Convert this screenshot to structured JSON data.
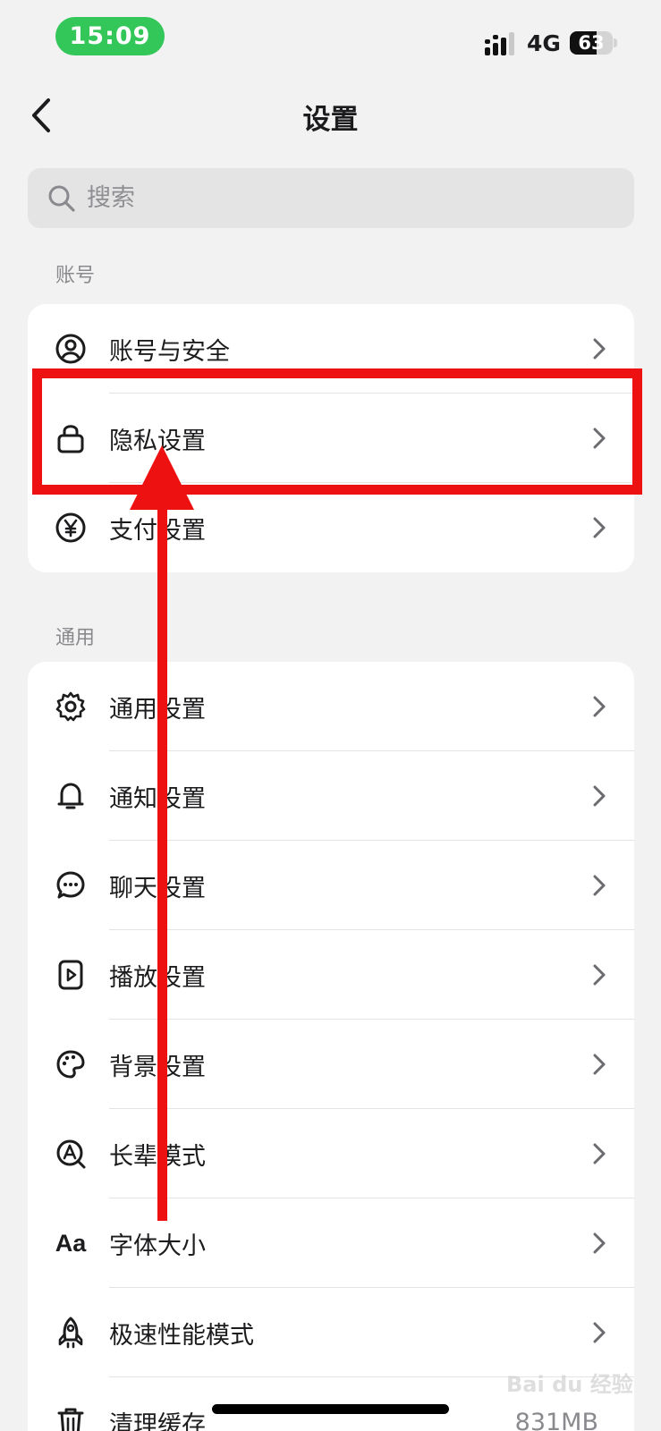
{
  "status_bar": {
    "time": "15:09",
    "network": "4G",
    "battery": 63
  },
  "nav": {
    "title": "设置",
    "back_icon": "chevron-left-icon"
  },
  "search": {
    "placeholder": "搜索"
  },
  "sections": {
    "account": {
      "label": "账号",
      "items": [
        {
          "label": "账号与安全",
          "icon": "user-circle-icon"
        },
        {
          "label": "隐私设置",
          "icon": "lock-icon"
        },
        {
          "label": "支付设置",
          "icon": "yen-icon"
        }
      ]
    },
    "general": {
      "label": "通用",
      "items": [
        {
          "label": "通用设置",
          "icon": "gear-icon"
        },
        {
          "label": "通知设置",
          "icon": "bell-icon"
        },
        {
          "label": "聊天设置",
          "icon": "chat-bubble-icon"
        },
        {
          "label": "播放设置",
          "icon": "play-file-icon"
        },
        {
          "label": "背景设置",
          "icon": "palette-icon"
        },
        {
          "label": "长辈模式",
          "icon": "elder-mode-icon"
        },
        {
          "label": "字体大小",
          "icon": "font-size-icon",
          "icon_text": "Aa"
        },
        {
          "label": "极速性能模式",
          "icon": "rocket-icon"
        },
        {
          "label": "清理缓存",
          "icon": "trash-icon",
          "value": "831MB"
        }
      ]
    }
  },
  "annotation": {
    "highlight_color": "#ee1111"
  },
  "watermark": {
    "text": "Bai du 经验"
  }
}
